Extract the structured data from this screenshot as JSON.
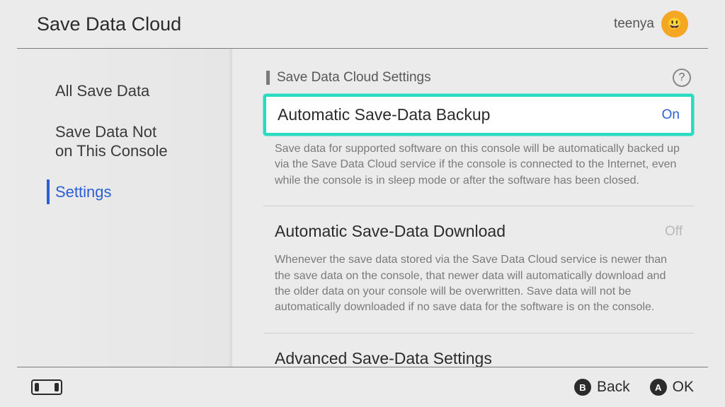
{
  "header": {
    "title": "Save Data Cloud",
    "username": "teenya",
    "avatar_emoji": "😃"
  },
  "sidebar": {
    "items": [
      {
        "label": "All Save Data",
        "selected": false
      },
      {
        "label": "Save Data Not\non This Console",
        "selected": false
      },
      {
        "label": "Settings",
        "selected": true
      }
    ]
  },
  "main": {
    "heading": "Save Data Cloud Settings",
    "help_glyph": "?",
    "rows": [
      {
        "label": "Automatic Save-Data Backup",
        "value": "On",
        "value_state": "on",
        "highlight": true,
        "description": "Save data for supported software on this console will be automatically backed up via the Save Data Cloud service if the console is connected to the Internet, even while the console is in sleep mode or after the software has been closed."
      },
      {
        "label": "Automatic Save-Data Download",
        "value": "Off",
        "value_state": "off",
        "highlight": false,
        "description": "Whenever the save data stored via the Save Data Cloud service is newer than the save data on the console, that newer data will automatically download and the older data on your console will be overwritten. Save data will not be automatically downloaded if no save data for the software is on the console."
      },
      {
        "label": "Advanced Save-Data Settings",
        "value": "",
        "value_state": "none",
        "highlight": false,
        "description": ""
      }
    ]
  },
  "footer": {
    "back_glyph": "B",
    "back_label": "Back",
    "ok_glyph": "A",
    "ok_label": "OK"
  }
}
